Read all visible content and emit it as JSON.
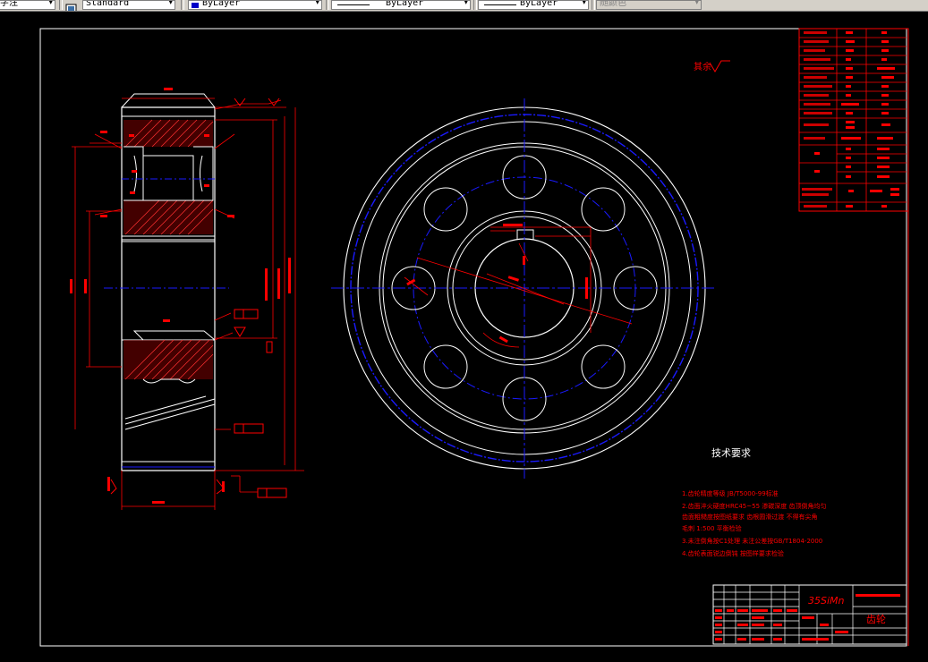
{
  "toolbar": {
    "text_style_prefix": "字注",
    "dim_style": "Standard",
    "layer": "ByLayer",
    "linetype": "ByLayer",
    "lineweight": "ByLayer",
    "plot_style": "随颜色",
    "dropdown_glyph": "▾"
  },
  "drawing": {
    "tech_title": "技术要求",
    "tech_notes": [
      "1.齿轮精度等级 JB/T5000-99标准",
      "2.齿面淬火硬度HRC45~55 渗碳深度 齿顶倒角均匀",
      "  齿面粗糙度按图纸要求 齿根圆滑过渡 不得有尖角",
      "  毛刺 1:500 平衡检验",
      "3.未注倒角按C1处理 未注公差按GB/T1804-2000",
      "4.齿轮表面锐边倒钝 按图样要求检验"
    ],
    "material": "35SiMn",
    "part_name": "齿轮",
    "title_small": "零件图号",
    "rough_symbol": "其余"
  },
  "colors": {
    "background": "#000000",
    "red": "#ff0000",
    "white": "#ffffff",
    "blue": "#1a1aff",
    "toolbar": "#d4d0c8"
  }
}
